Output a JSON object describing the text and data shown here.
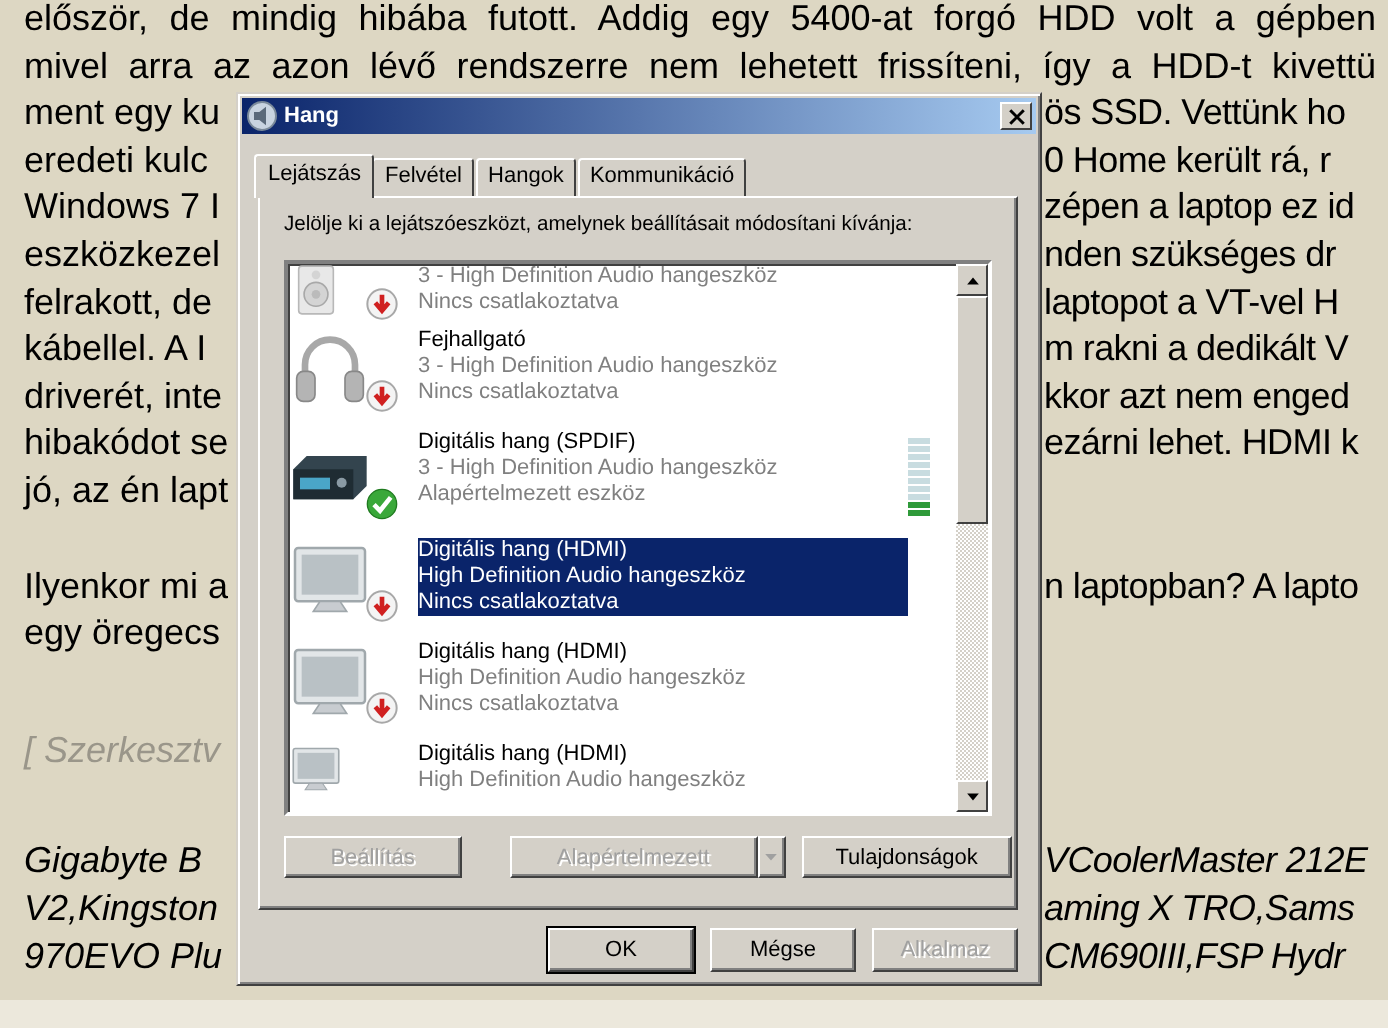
{
  "page": {
    "paragraphs": [
      {
        "kind": "body",
        "lines": [
          {
            "text": "először, de mindig hibába futott. Addig egy 5400-at forgó HDD volt a gépben"
          },
          {
            "text": "mivel arra az azon lévő rendszerre nem lehetett frissíteni, így a HDD-t kivettü"
          },
          {
            "left": "ment egy ku",
            "right": "ös SSD. Vettünk ho"
          },
          {
            "left": "eredeti kulc",
            "right": "0 Home került rá, r"
          },
          {
            "left": "Windows 7 I",
            "right": "zépen a laptop ez id"
          },
          {
            "left": "eszközkezel",
            "right": "nden szükséges dr"
          },
          {
            "left": "felrakott, de",
            "right": "laptopot a VT-vel H"
          },
          {
            "left": "kábellel. A I",
            "right": "m rakni a dedikált V"
          },
          {
            "left": "driverét, inte",
            "right": "kkor azt nem enged"
          },
          {
            "left": "hibakódot se",
            "right": "ezárni lehet. HDMI k"
          },
          {
            "left": "jó, az én lapt"
          }
        ]
      },
      {
        "kind": "body",
        "lines": [
          {
            "left": "Ilyenkor mi a",
            "right": "n laptopban? A lapto"
          },
          {
            "left": "egy öregecs"
          }
        ]
      },
      {
        "kind": "edit_note",
        "lines": [
          {
            "left": "[ Szerkesztv"
          }
        ]
      },
      {
        "kind": "specs",
        "lines": [
          {
            "left": "Gigabyte B",
            "right": "VCoolerMaster 212E"
          },
          {
            "left": "V2,Kingston",
            "right": "aming X TRO,Sams"
          },
          {
            "left": "970EVO Plu",
            "right": "CM690III,FSP Hydr"
          }
        ]
      }
    ]
  },
  "dialog": {
    "title": "Hang",
    "tabs": [
      {
        "label": "Lejátszás",
        "selected": true
      },
      {
        "label": "Felvétel",
        "selected": false
      },
      {
        "label": "Hangok",
        "selected": false
      },
      {
        "label": "Kommunikáció",
        "selected": false
      }
    ],
    "instruction": "Jelölje ki a lejátszóeszközt, amelynek beállításait módosítani kívánja:",
    "devices": [
      {
        "kind": "speaker",
        "lines": [
          "3 - High Definition Audio hangeszköz",
          "Nincs csatlakoztatva"
        ],
        "unplugged": true,
        "is_default": false,
        "selected": false
      },
      {
        "kind": "headphones",
        "name": "Fejhallgató",
        "lines": [
          "3 - High Definition Audio hangeszköz",
          "Nincs csatlakoztatva"
        ],
        "unplugged": true,
        "is_default": false,
        "selected": false
      },
      {
        "kind": "receiver",
        "name": "Digitális hang (SPDIF)",
        "lines": [
          "3 - High Definition Audio hangeszköz",
          "Alapértelmezett eszköz"
        ],
        "unplugged": false,
        "is_default": true,
        "selected": false,
        "level": 0.2
      },
      {
        "kind": "monitor",
        "name": "Digitális hang (HDMI)",
        "lines": [
          "High Definition Audio hangeszköz",
          "Nincs csatlakoztatva"
        ],
        "unplugged": true,
        "is_default": false,
        "selected": true
      },
      {
        "kind": "monitor",
        "name": "Digitális hang (HDMI)",
        "lines": [
          "High Definition Audio hangeszköz",
          "Nincs csatlakoztatva"
        ],
        "unplugged": true,
        "is_default": false,
        "selected": false
      },
      {
        "kind": "monitor",
        "name": "Digitális hang (HDMI)",
        "lines": [
          "High Definition Audio hangeszköz"
        ],
        "unplugged": false,
        "is_default": false,
        "selected": false
      }
    ],
    "device_buttons": [
      {
        "kind": "plain",
        "label": "Beállítás",
        "disabled": true
      },
      {
        "kind": "split",
        "label": "Alapértelmezett",
        "disabled": true
      },
      {
        "kind": "plain",
        "label": "Tulajdonságok",
        "disabled": false
      }
    ],
    "buttons": [
      {
        "label": "OK",
        "disabled": false,
        "default": true
      },
      {
        "label": "Mégse",
        "disabled": false,
        "default": false
      },
      {
        "label": "Alkalmaz",
        "disabled": true,
        "default": false
      }
    ]
  }
}
